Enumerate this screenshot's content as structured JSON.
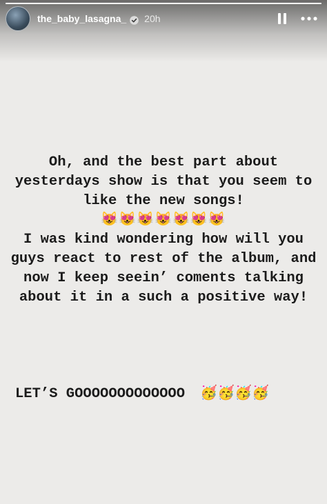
{
  "header": {
    "username": "the_baby_lasagna_",
    "time": "20h",
    "progress_fraction": 1.0
  },
  "story": {
    "paragraph1": "Oh, and the best part about yesterdays show is that you seem to like the new songs!",
    "emojis1": "😻😻😻😻😻😻😻",
    "paragraph2": "I was kind wondering how will you guys react to rest of the album, and now I keep seein’ coments talking about it in a such a positive way!",
    "lets_go": "LET’S GOOOOOOOOOOOOO",
    "party_emojis": "🥳🥳🥳🥳"
  },
  "colors": {
    "background": "#ecebe9",
    "text": "#1b1b1b",
    "header_text": "#ffffff"
  },
  "icons": [
    "verified-badge-icon",
    "pause-icon",
    "more-options-icon"
  ]
}
